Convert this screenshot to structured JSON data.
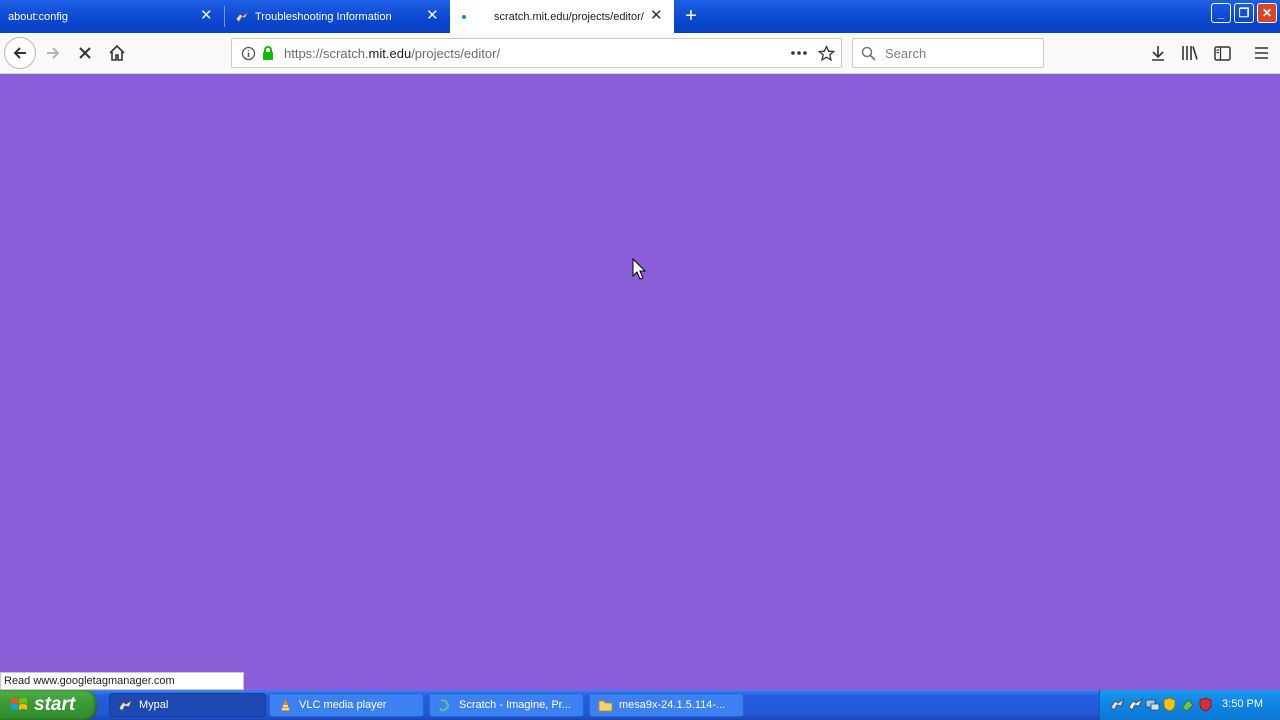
{
  "browser": {
    "tabs": [
      {
        "label": "about:config",
        "active": false
      },
      {
        "label": "Troubleshooting Information",
        "active": false
      },
      {
        "label": "scratch.mit.edu/projects/editor/",
        "active": true
      }
    ],
    "url": {
      "prefix": "https://scratch.",
      "domain": "mit.edu",
      "path": "/projects/editor/"
    },
    "search_placeholder": "Search",
    "status_text": "Read www.googletagmanager.com",
    "content_background": "#8a5ed9"
  },
  "taskbar": {
    "start_label": "start",
    "items": [
      {
        "label": "Mypal",
        "icon": "mypal-icon",
        "active": true
      },
      {
        "label": "VLC media player",
        "icon": "vlc-icon",
        "active": false
      },
      {
        "label": "Scratch - Imagine, Pr...",
        "icon": "scratch-icon",
        "active": false
      },
      {
        "label": "mesa9x-24.1.5.114-...",
        "icon": "folder-icon",
        "active": false
      }
    ],
    "clock": "3:50 PM"
  }
}
